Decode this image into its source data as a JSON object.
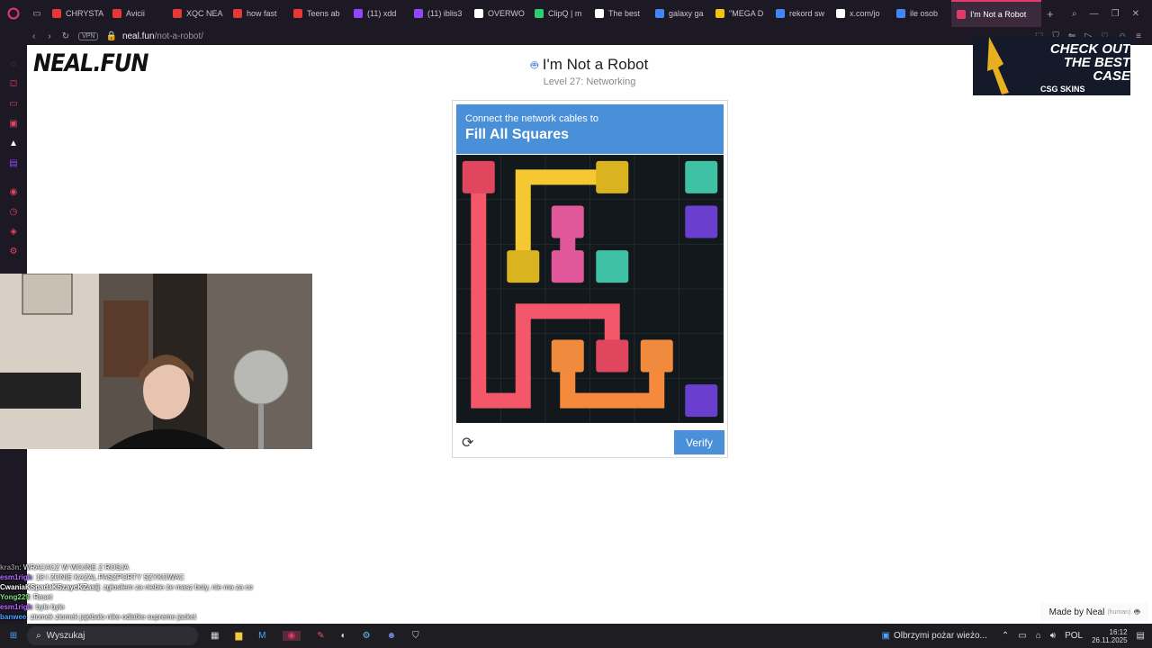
{
  "browser": {
    "tabs": [
      {
        "label": "CHRYSTA",
        "color": "#e53935"
      },
      {
        "label": "Avicii",
        "color": "#e53935"
      },
      {
        "label": "XQC NEA",
        "color": "#e53935"
      },
      {
        "label": "how fast",
        "color": "#e53935"
      },
      {
        "label": "Teens ab",
        "color": "#e53935"
      },
      {
        "label": "(11) xdd",
        "color": "#9146ff"
      },
      {
        "label": "(11) iblis3",
        "color": "#9146ff"
      },
      {
        "label": "OVERWO",
        "color": "#ffffff"
      },
      {
        "label": "ClipQ | m",
        "color": "#2ecc71"
      },
      {
        "label": "The best",
        "color": "#ffffff"
      },
      {
        "label": "galaxy ga",
        "color": "#4285f4"
      },
      {
        "label": "\"MEGA D",
        "color": "#f4c20d"
      },
      {
        "label": "rekord sw",
        "color": "#4285f4"
      },
      {
        "label": "x.com/jo",
        "color": "#ffffff"
      },
      {
        "label": "ile osob",
        "color": "#4285f4"
      },
      {
        "label": "I'm Not a Robot",
        "color": "#e5386b",
        "active": true
      }
    ],
    "url_domain": "neal.fun",
    "url_path": "/not-a-robot/",
    "vpn_label": "VPN"
  },
  "page": {
    "logo": "NEAL.FUN",
    "title": "I'm Not a Robot",
    "level": "Level 27: Networking",
    "made_by": "Made by Neal",
    "made_by_note": "(human)"
  },
  "captcha": {
    "instruction": "Connect the network cables to",
    "goal": "Fill All Squares",
    "verify_label": "Verify",
    "grid_size": 6,
    "nodes": [
      {
        "row": 0,
        "col": 0,
        "color": "#e0475e"
      },
      {
        "row": 0,
        "col": 3,
        "color": "#d9b320"
      },
      {
        "row": 0,
        "col": 5,
        "color": "#3fc1a5"
      },
      {
        "row": 1,
        "col": 2,
        "color": "#e0579a"
      },
      {
        "row": 1,
        "col": 5,
        "color": "#6a3fd0"
      },
      {
        "row": 2,
        "col": 1,
        "color": "#d9b320"
      },
      {
        "row": 2,
        "col": 2,
        "color": "#e0579a"
      },
      {
        "row": 2,
        "col": 3,
        "color": "#3fc1a5"
      },
      {
        "row": 4,
        "col": 2,
        "color": "#f08a3c"
      },
      {
        "row": 4,
        "col": 3,
        "color": "#e0475e"
      },
      {
        "row": 4,
        "col": 4,
        "color": "#f08a3c"
      },
      {
        "row": 5,
        "col": 5,
        "color": "#6a3fd0"
      }
    ],
    "paths": [
      {
        "color": "#f5c832",
        "cells": [
          [
            2,
            1
          ],
          [
            1,
            1
          ],
          [
            0,
            1
          ],
          [
            0,
            2
          ],
          [
            0,
            3
          ]
        ]
      },
      {
        "color": "#e0579a",
        "cells": [
          [
            1,
            2
          ],
          [
            2,
            2
          ]
        ]
      },
      {
        "color": "#f5576a",
        "cells": [
          [
            0,
            0
          ],
          [
            1,
            0
          ],
          [
            2,
            0
          ],
          [
            3,
            0
          ],
          [
            4,
            0
          ],
          [
            5,
            0
          ],
          [
            5,
            1
          ],
          [
            4,
            1
          ],
          [
            3,
            1
          ],
          [
            3,
            2
          ],
          [
            3,
            3
          ],
          [
            4,
            3
          ]
        ]
      },
      {
        "color": "#f58a3c",
        "cells": [
          [
            4,
            2
          ],
          [
            5,
            2
          ],
          [
            5,
            3
          ],
          [
            5,
            4
          ],
          [
            4,
            4
          ]
        ]
      }
    ]
  },
  "ad": {
    "line1": "CHECK OUT",
    "line2": "THE BEST",
    "line3": "CASE",
    "brand": "CSG SKINS"
  },
  "chat": [
    {
      "user": "kra3n",
      "text": "WRACACZ W WOJNE Z ROSJA",
      "color": "#888888"
    },
    {
      "user": "esm1righ",
      "text": "18 I ZONIE KAZAL PASZPORTY SZYKOWAC",
      "color": "#b36cff"
    },
    {
      "user": "CwaniaKSpadaKSzaycKZasij",
      "text": "zgłosiłem za niebie że masz boty, nie ma za co",
      "color": "#ffffff"
    },
    {
      "user": "Yong229",
      "text": "Reset",
      "color": "#7be37b"
    },
    {
      "user": "esm1righ",
      "text": "byle byle",
      "color": "#b36cff"
    },
    {
      "user": "banwee",
      "text": "ziomek ziomek jajebalo nike odlatke supreme jacket",
      "color": "#4fa3ff"
    }
  ],
  "taskbar": {
    "search": "Wyszukaj",
    "news": "Olbrzymi pożar wieżo...",
    "lang": "POL",
    "time": "16:12",
    "date": "26.11.2025"
  }
}
